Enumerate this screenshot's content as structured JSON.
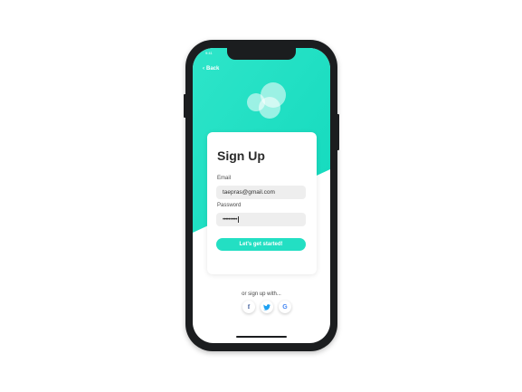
{
  "status_bar": {
    "time": "9:41"
  },
  "nav": {
    "back_label": "Back"
  },
  "form": {
    "title": "Sign Up",
    "email": {
      "label": "Email",
      "value": "taepras@gmail.com"
    },
    "password": {
      "label": "Password",
      "value": "••••••••••"
    },
    "submit_label": "Let's get started!"
  },
  "social": {
    "prompt": "or sign up with...",
    "providers": [
      {
        "name": "facebook",
        "glyph": "f",
        "color": "#3b5998"
      },
      {
        "name": "twitter",
        "glyph": "",
        "color": "#1da1f2"
      },
      {
        "name": "google",
        "glyph": "G",
        "color": "#4285f4"
      }
    ]
  },
  "colors": {
    "accent": "#23dfc3",
    "accent_light": "#3de8cf",
    "frame": "#1b1d1f"
  }
}
